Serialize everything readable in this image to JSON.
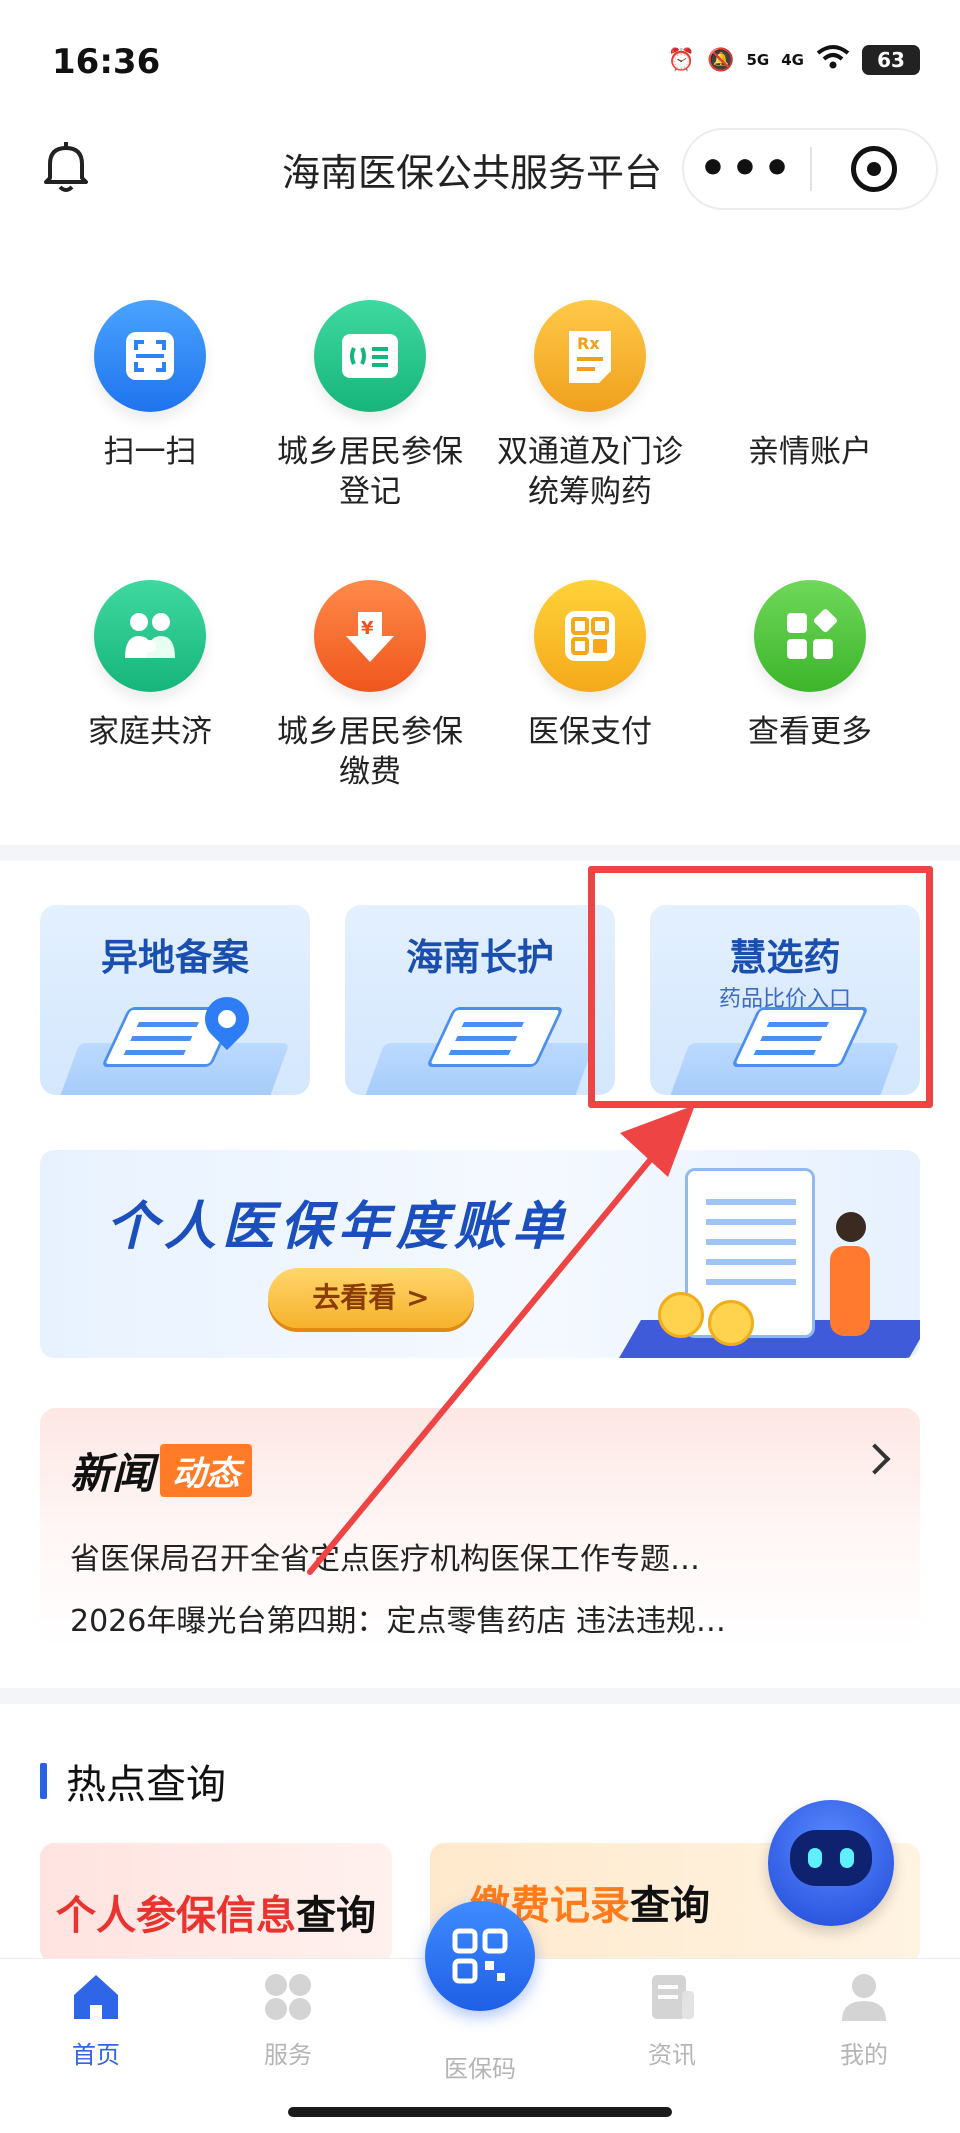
{
  "status_bar": {
    "time": "16:36",
    "signal_1": "5G",
    "signal_2": "4G",
    "battery": "63"
  },
  "header": {
    "title": "海南医保公共服务平台"
  },
  "grid": {
    "row1": [
      {
        "label": "扫一扫",
        "icon": "scan-icon",
        "color": "#2f82f5"
      },
      {
        "label": "城乡居民参保登记",
        "icon": "registration-card-icon",
        "color": "#22c48a"
      },
      {
        "label": "双通道及门诊统筹购药",
        "icon": "prescription-icon",
        "color": "#f3a826"
      },
      {
        "label": "亲情账户",
        "icon": "family-account-icon",
        "color": "#ffffff"
      }
    ],
    "row2": [
      {
        "label": "家庭共济",
        "icon": "family-icon",
        "color": "#22c48a"
      },
      {
        "label": "城乡居民参保缴费",
        "icon": "payment-icon",
        "color": "#ff6a2a"
      },
      {
        "label": "医保支付",
        "icon": "qr-pay-icon",
        "color": "#f8b82c"
      },
      {
        "label": "查看更多",
        "icon": "more-apps-icon",
        "color": "#4fc63c"
      }
    ]
  },
  "cards": [
    {
      "title": "异地备案"
    },
    {
      "title": "海南长护"
    },
    {
      "title": "慧选药",
      "subtitle": "药品比价入口"
    }
  ],
  "banner": {
    "title": "个人医保年度账单",
    "button": "去看看 >"
  },
  "news": {
    "logo_a": "新闻",
    "logo_b": "动态",
    "items": [
      "省医保局召开全省定点医疗机构医保工作专题…",
      "2026年曝光台第四期：定点零售药店 违法违规…"
    ]
  },
  "hot": {
    "title": "热点查询",
    "q1": {
      "highlight": "个人参保信息",
      "tail": "查询"
    },
    "q2": {
      "highlight": "缴费记录",
      "tail": "查询"
    }
  },
  "tabbar": {
    "home": "首页",
    "services": "服务",
    "qr": "医保码",
    "news": "资讯",
    "mine": "我的"
  },
  "colors": {
    "accent": "#2f66e8",
    "highlight_frame": "#ee4444"
  }
}
